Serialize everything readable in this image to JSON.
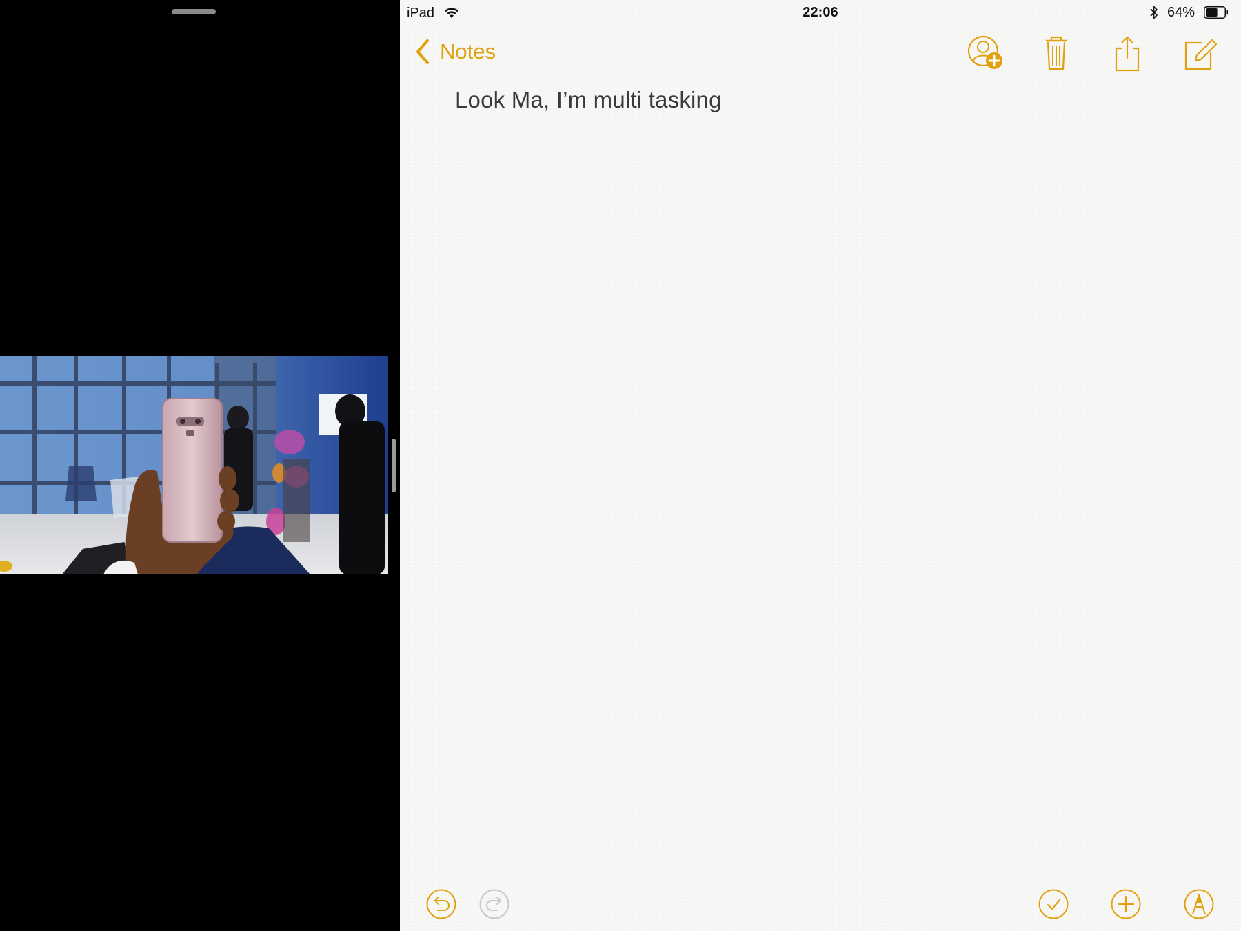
{
  "status_bar": {
    "carrier": "iPad",
    "time": "22:06",
    "battery_percent": "64%",
    "battery_level": 0.64,
    "icons": [
      "wifi-icon",
      "bluetooth-icon",
      "battery-icon"
    ]
  },
  "notes": {
    "back_label": "Notes",
    "note_text": "Look Ma, I’m multi tasking",
    "nav_icons": [
      "add-people-icon",
      "trash-icon",
      "share-icon",
      "compose-icon"
    ],
    "toolbar_icons": [
      "undo-icon",
      "redo-icon",
      "checklist-icon",
      "add-icon",
      "markup-icon"
    ]
  },
  "video_pane": {
    "content": "video-playing"
  },
  "colors": {
    "accent": "#e1a10f",
    "notes_background": "#f7f7f5",
    "video_background": "#000000"
  }
}
